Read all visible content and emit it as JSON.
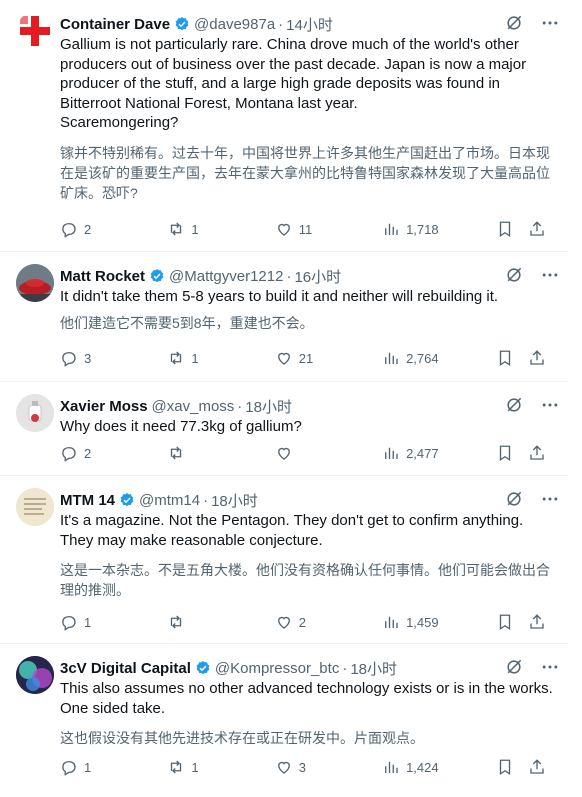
{
  "tweets": [
    {
      "name": "Container Dave",
      "handle": "@dave987a",
      "time": "14小时",
      "text": "Gallium is not particularly rare. China drove much of the world's other producers out of business over the past decade. Japan is now a major producer of the stuff, and a large high grade deposits was found in Bitterroot National Forest, Montana last year.\nScaremongering?",
      "translation": "镓并不特别稀有。过去十年，中国将世界上许多其他生产国赶出了市场。日本现在是该矿的重要生产国，去年在蒙大拿州的比特鲁特国家森林发现了大量高品位矿床。恐吓?",
      "replies": "2",
      "reposts": "1",
      "likes": "11",
      "views": "1,718"
    },
    {
      "name": "Matt Rocket",
      "handle": "@Mattgyver1212",
      "time": "16小时",
      "text": "It didn't take them 5-8 years to build it and neither will rebuilding it.",
      "translation": "他们建造它不需要5到8年，重建也不会。",
      "replies": "3",
      "reposts": "1",
      "likes": "21",
      "views": "2,764"
    },
    {
      "name": "Xavier Moss",
      "handle": "@xav_moss",
      "time": "18小时",
      "text": "Why does it need 77.3kg of gallium?",
      "translation": "",
      "replies": "2",
      "reposts": "",
      "likes": "",
      "views": "2,477"
    },
    {
      "name": "MTM 14",
      "handle": "@mtm14",
      "time": "18小时",
      "text": "It's a magazine.  Not the Pentagon.  They don't get to confirm anything.  They may make reasonable conjecture.",
      "translation": "这是一本杂志。不是五角大楼。他们没有资格确认任何事情。他们可能会做出合理的推测。",
      "replies": "1",
      "reposts": "",
      "likes": "2",
      "views": "1,459"
    },
    {
      "name": "3cV Digital Capital",
      "handle": "@Kompressor_btc",
      "time": "18小时",
      "text": "This also assumes no other advanced technology exists or is in the works.  One sided take.",
      "translation": "这也假设没有其他先进技术存在或正在研发中。片面观点。",
      "replies": "1",
      "reposts": "1",
      "likes": "3",
      "views": "1,424"
    }
  ],
  "colors": {
    "verified": "#1d9bf0",
    "muted": "#536471",
    "text": "#0f1419"
  }
}
